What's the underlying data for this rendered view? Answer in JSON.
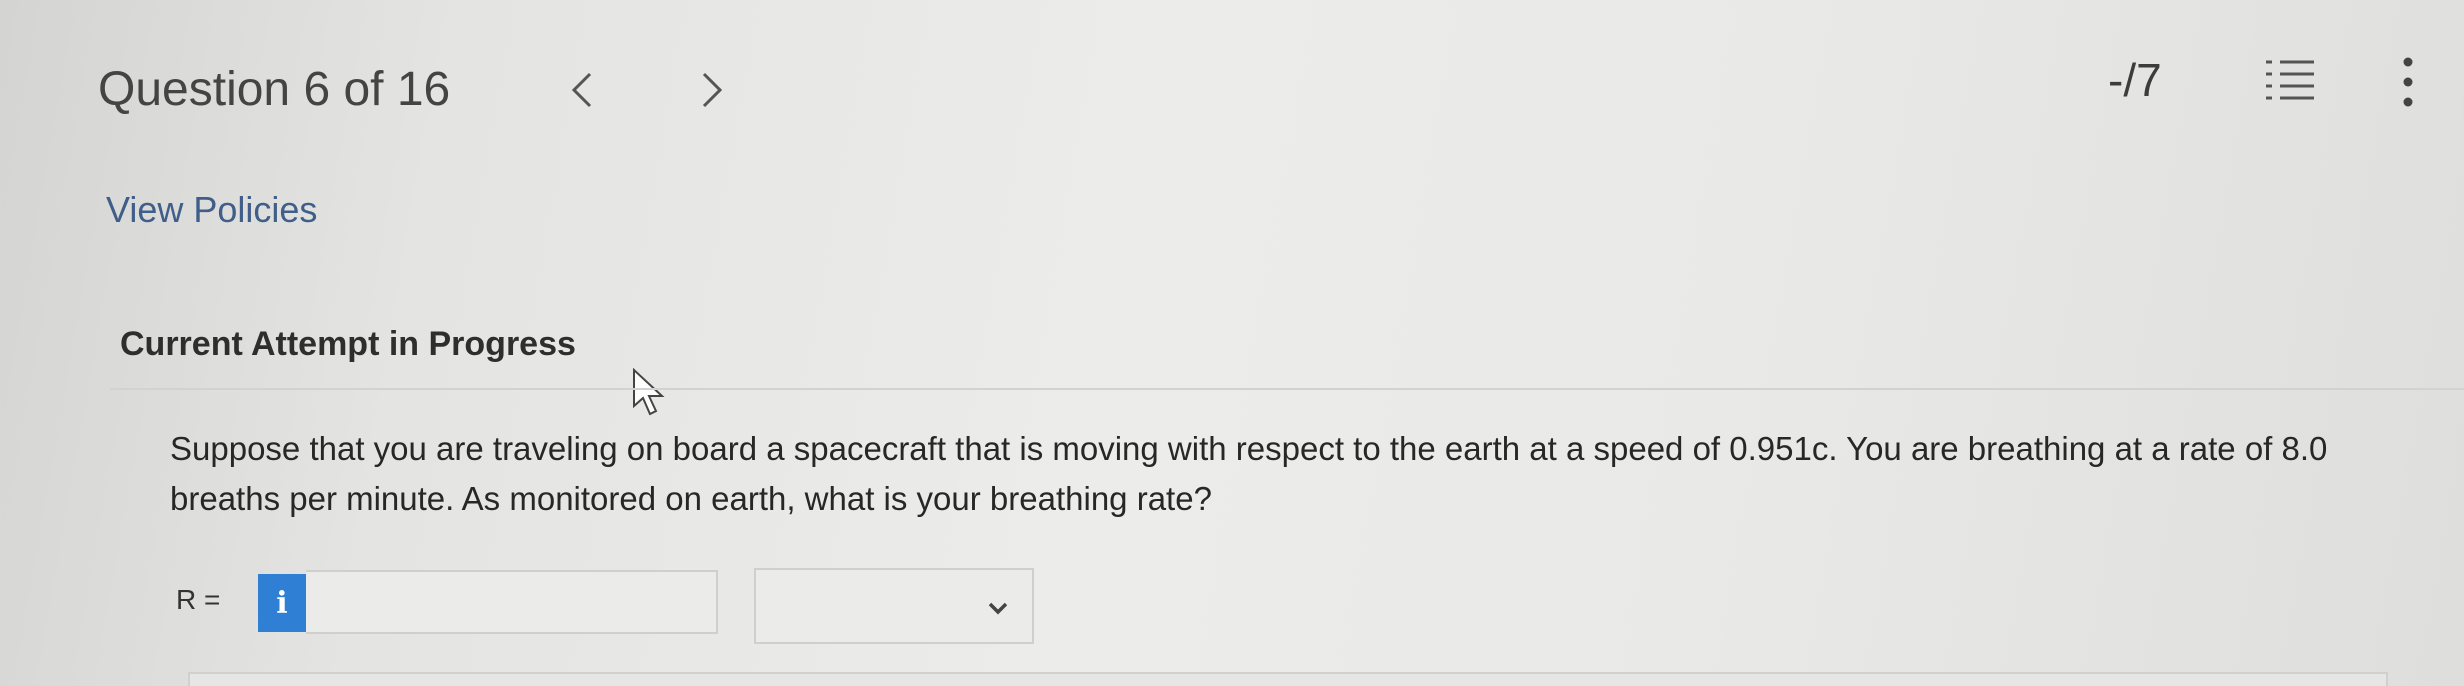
{
  "header": {
    "question_label": "Question 6 of 16",
    "score": "-/7"
  },
  "icons": {
    "prev": "chevron-left-icon",
    "next": "chevron-right-icon",
    "list": "numbered-list-icon",
    "more": "more-vertical-icon",
    "info": "info-icon",
    "dropdown": "chevron-down-icon",
    "cursor": "mouse-pointer-icon"
  },
  "policies_link": "View Policies",
  "attempt_status": "Current Attempt in Progress",
  "question_text": "Suppose that you are traveling on board a spacecraft that is moving with respect to the earth at a speed of 0.951c. You are breathing at a rate of 8.0 breaths per minute. As monitored on earth, what is your breathing rate?",
  "answer": {
    "label": "R =",
    "info_glyph": "i",
    "value": "",
    "unit_selected": ""
  },
  "colors": {
    "link": "#3f5f8a",
    "info_badge": "#2f7fd4"
  }
}
